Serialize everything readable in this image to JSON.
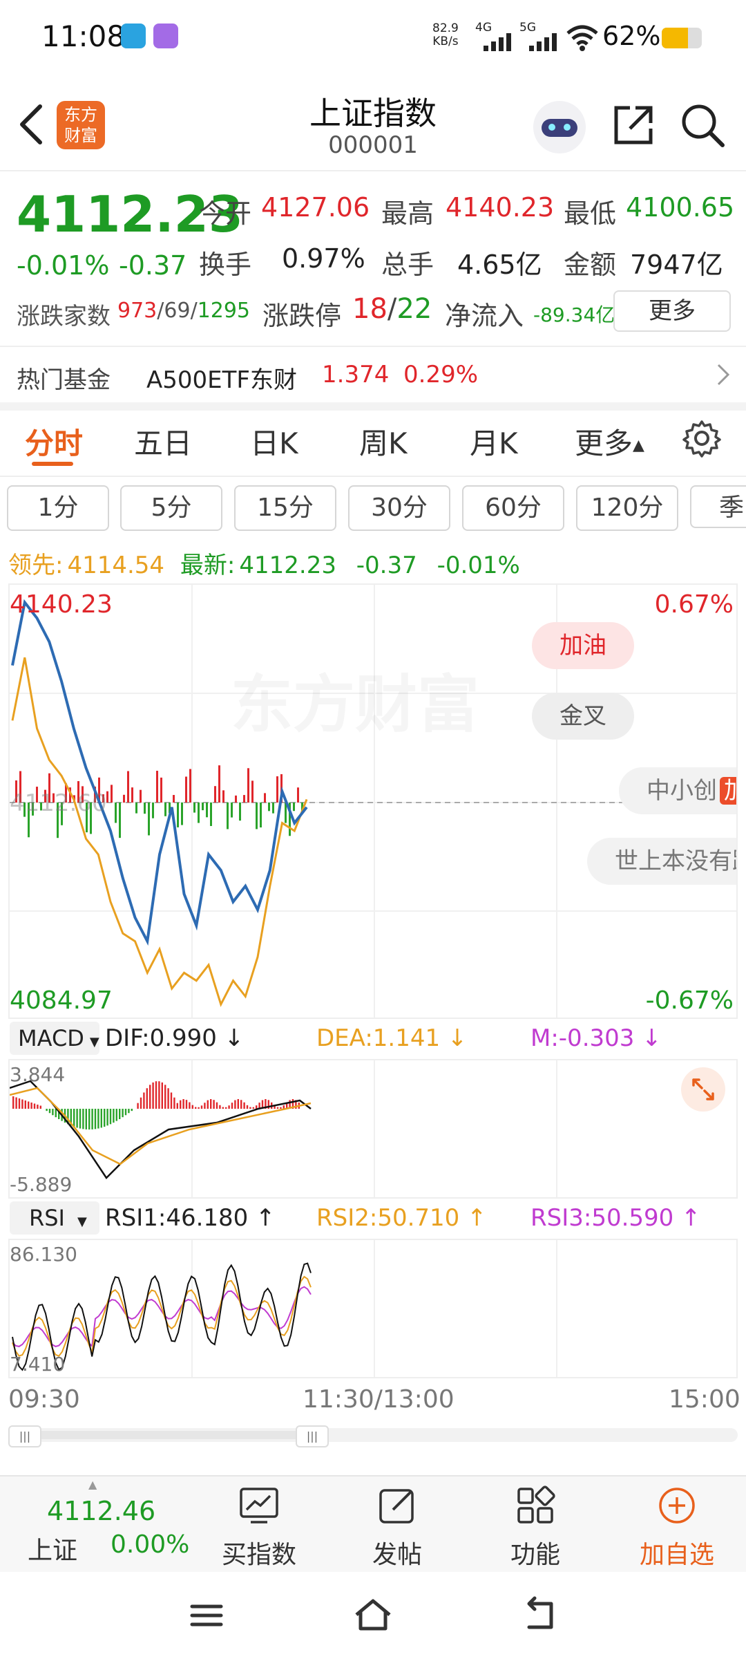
{
  "status_bar": {
    "time": "11:08",
    "net_speed_top": "82.9",
    "net_speed_unit": "KB/s",
    "sig1": "4G",
    "sig2": "5G",
    "battery": "62%"
  },
  "header": {
    "title": "上证指数",
    "code": "000001",
    "logo_text": "东方财富"
  },
  "quote": {
    "price": "4112.23",
    "change_pct": "-0.01%",
    "change": "-0.37",
    "open_label": "今开",
    "open": "4127.06",
    "high_label": "最高",
    "high": "4140.23",
    "low_label": "最低",
    "low": "4100.65",
    "turnover_label": "换手",
    "turnover": "0.97%",
    "volume_label": "总手",
    "volume": "4.65亿",
    "amount_label": "金额",
    "amount": "7947亿",
    "advdec_label": "涨跌家数",
    "adv": "973",
    "flat": "69",
    "dec": "1295",
    "limit_label": "涨跌停",
    "limit_up": "18",
    "limit_down": "22",
    "netflow_label": "净流入",
    "netflow": "-89.34亿",
    "more_label": "更多"
  },
  "hot_fund": {
    "label": "热门基金",
    "name": "A500ETF东财",
    "price": "1.374",
    "pct": "0.29%"
  },
  "tabs": [
    "分时",
    "五日",
    "日K",
    "周K",
    "月K",
    "更多"
  ],
  "periods": [
    "1分",
    "5分",
    "15分",
    "30分",
    "60分",
    "120分",
    "季"
  ],
  "legend": {
    "lead_label": "领先:",
    "lead": "4114.54",
    "latest_label": "最新:",
    "latest": "4112.23",
    "chg": "-0.37",
    "pct": "-0.01%"
  },
  "chart": {
    "max_price": "4140.23",
    "min_price": "4084.97",
    "max_pct": "0.67%",
    "min_pct": "-0.67%",
    "watermark": "东方财富",
    "ref_price": "4112.60",
    "bubbles": [
      "加油",
      "金叉",
      "中小创",
      "世上本没有路"
    ],
    "bubble_badge": "加"
  },
  "macd": {
    "name": "MACD",
    "dif": "DIF:0.990 ↓",
    "dea": "DEA:1.141 ↓",
    "m": "M:-0.303 ↓",
    "max": "3.844",
    "min": "-5.889"
  },
  "rsi": {
    "name": "RSI",
    "rsi1": "RSI1:46.180 ↑",
    "rsi2": "RSI2:50.710 ↑",
    "rsi3": "RSI3:50.590 ↑",
    "max": "86.130",
    "min": "7.410"
  },
  "time_axis": [
    "09:30",
    "11:30/13:00",
    "15:00"
  ],
  "bottom_bar": {
    "index_name": "上证",
    "index_value": "4112.46",
    "index_pct": "0.00%",
    "items": [
      "买指数",
      "发帖",
      "功能",
      "加自选"
    ]
  },
  "chart_data": {
    "type": "line",
    "title": "",
    "xlabel": "",
    "ylabel": "",
    "x": [
      "09:30",
      "11:30/13:00",
      "15:00"
    ],
    "ylim": [
      4084.97,
      4140.23
    ],
    "series": [
      {
        "values": [
          4130,
          4138,
          4136,
          4133,
          4128,
          4122,
          4117,
          4113,
          4109,
          4103,
          4098,
          4095,
          4106,
          4112,
          4101,
          4097,
          4106,
          4104,
          4100,
          4102,
          4099,
          4104,
          4114,
          4110,
          4112
        ]
      },
      {
        "values": [
          4123,
          4131,
          4122,
          4118,
          4116,
          4113,
          4108,
          4106,
          4100,
          4096,
          4095,
          4091,
          4094,
          4089,
          4091,
          4090,
          4092,
          4087,
          4090,
          4088,
          4093,
          4102,
          4110,
          4109,
          4113
        ]
      }
    ]
  }
}
